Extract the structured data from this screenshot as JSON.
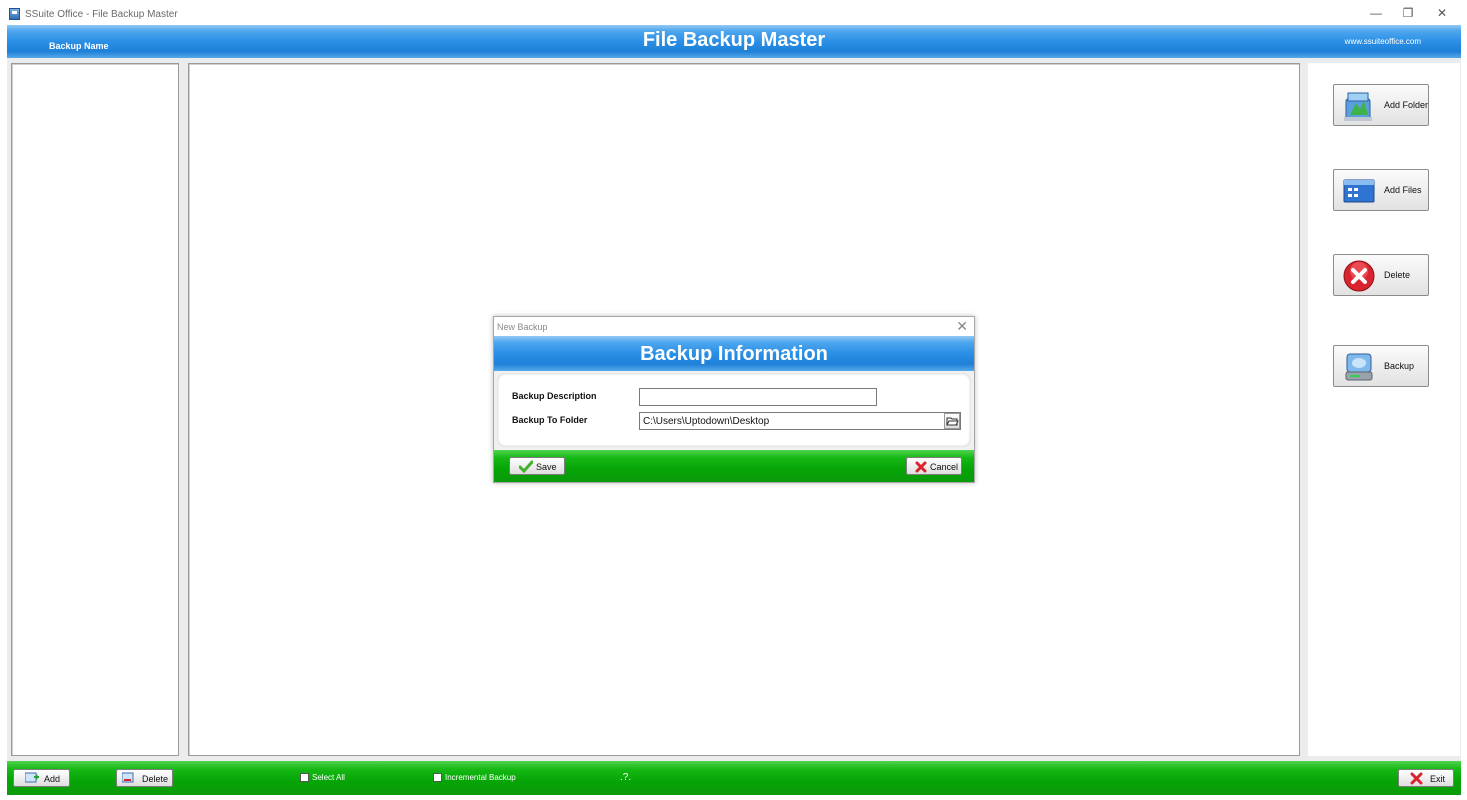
{
  "window": {
    "title": "SSuite Office - File Backup Master",
    "minimize": "—",
    "restore": "❐",
    "close": "✕"
  },
  "header": {
    "left_label": "Backup Name",
    "title": "File Backup Master",
    "website": "www.ssuiteoffice.com"
  },
  "sidebar": {
    "add_folder": "Add Folder",
    "add_files": "Add Files",
    "delete": "Delete",
    "backup": "Backup"
  },
  "bottom": {
    "add": "Add",
    "delete": "Delete",
    "select_all": "Select All",
    "incremental": "Incremental Backup",
    "help": ".?.",
    "exit": "Exit"
  },
  "dialog": {
    "window_title": "New Backup",
    "header": "Backup Information",
    "description_label": "Backup Description",
    "description_value": "",
    "folder_label": "Backup To Folder",
    "folder_value": "C:\\Users\\Uptodown\\Desktop",
    "save": "Save",
    "cancel": "Cancel",
    "close": "✕"
  },
  "colors": {
    "header_blue": "#2a8fe6",
    "footer_green": "#06a406"
  }
}
